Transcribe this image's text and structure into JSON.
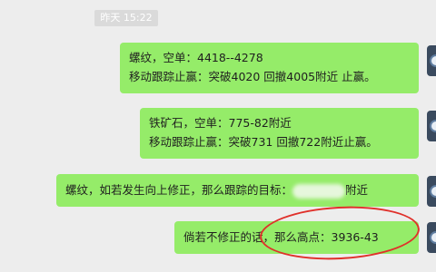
{
  "timestamp": "昨天 15:22",
  "messages": [
    {
      "lines": [
        "螺纹，空单：4418--4278",
        "移动跟踪止赢：突破4020 回撤4005附近 止赢。"
      ]
    },
    {
      "lines": [
        "铁矿石，空单：775-82附近",
        "移动跟踪止赢：突破731 回撤722附近止赢。"
      ]
    },
    {
      "text_before": "螺纹，如若发生向上修正，那么跟踪的目标：",
      "text_after": "附近"
    },
    {
      "lines": [
        "倘若不修正的话，那么高点：3936-43"
      ]
    }
  ],
  "colors": {
    "bubble": "#95ec69",
    "background": "#ededed",
    "annotation": "#e0302a"
  }
}
